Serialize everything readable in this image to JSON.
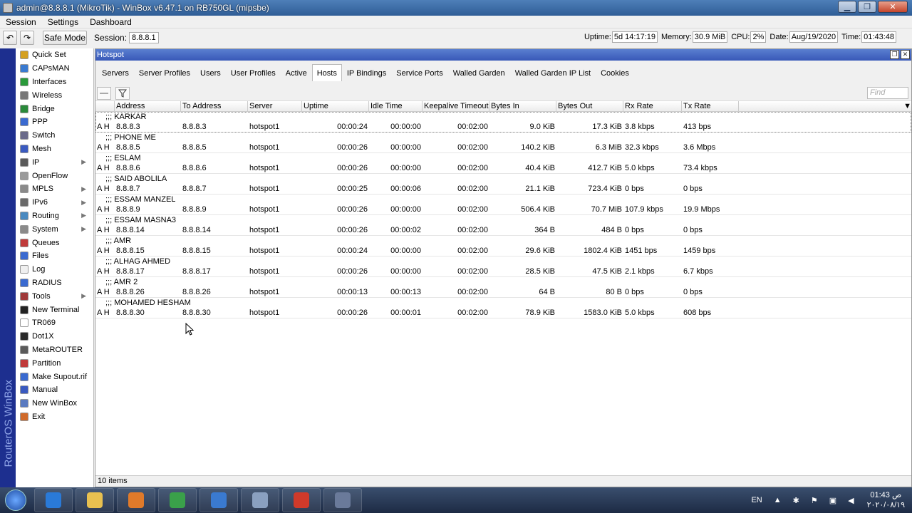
{
  "window": {
    "title": "admin@8.8.8.1 (MikroTik) - WinBox v6.47.1 on RB750GL (mipsbe)",
    "buttons": [
      "▁",
      "❐",
      "✕"
    ]
  },
  "menu": [
    "Session",
    "Settings",
    "Dashboard"
  ],
  "toolbar": {
    "undo": "↶",
    "redo": "↷",
    "safe_mode": "Safe Mode",
    "session_label": "Session:",
    "session_value": "8.8.8.1",
    "stats": [
      {
        "label": "Uptime:",
        "value": "5d 14:17:19"
      },
      {
        "label": "Memory:",
        "value": "30.9 MiB"
      },
      {
        "label": "CPU:",
        "value": "2%"
      },
      {
        "label": "Date:",
        "value": "Aug/19/2020"
      },
      {
        "label": "Time:",
        "value": "01:43:48"
      }
    ]
  },
  "brand": "RouterOS WinBox",
  "sidebar": {
    "items": [
      {
        "label": "Quick Set",
        "icon": "quick-set-icon",
        "color": "#d4a020",
        "sub": false
      },
      {
        "label": "CAPsMAN",
        "icon": "capsman-icon",
        "color": "#3a7ad0",
        "sub": false
      },
      {
        "label": "Interfaces",
        "icon": "interfaces-icon",
        "color": "#2a9a3a",
        "sub": false
      },
      {
        "label": "Wireless",
        "icon": "wireless-icon",
        "color": "#777777",
        "sub": false
      },
      {
        "label": "Bridge",
        "icon": "bridge-icon",
        "color": "#2a8a3a",
        "sub": false
      },
      {
        "label": "PPP",
        "icon": "ppp-icon",
        "color": "#3a6ad0",
        "sub": false
      },
      {
        "label": "Switch",
        "icon": "switch-icon",
        "color": "#6a6a8a",
        "sub": false
      },
      {
        "label": "Mesh",
        "icon": "mesh-icon",
        "color": "#3a5ac0",
        "sub": false
      },
      {
        "label": "IP",
        "icon": "ip-icon",
        "color": "#5a5a5a",
        "sub": true
      },
      {
        "label": "OpenFlow",
        "icon": "openflow-icon",
        "color": "#9a9a9a",
        "sub": false
      },
      {
        "label": "MPLS",
        "icon": "mpls-icon",
        "color": "#8a8a8a",
        "sub": true
      },
      {
        "label": "IPv6",
        "icon": "ipv6-icon",
        "color": "#6a6a6a",
        "sub": true
      },
      {
        "label": "Routing",
        "icon": "routing-icon",
        "color": "#4a8ac0",
        "sub": true
      },
      {
        "label": "System",
        "icon": "system-icon",
        "color": "#8a8a8a",
        "sub": true
      },
      {
        "label": "Queues",
        "icon": "queues-icon",
        "color": "#c03a3a",
        "sub": false
      },
      {
        "label": "Files",
        "icon": "files-icon",
        "color": "#3a6ad0",
        "sub": false
      },
      {
        "label": "Log",
        "icon": "log-icon",
        "color": "#f0f0f0",
        "sub": false
      },
      {
        "label": "RADIUS",
        "icon": "radius-icon",
        "color": "#3a6ad0",
        "sub": false
      },
      {
        "label": "Tools",
        "icon": "tools-icon",
        "color": "#a03a3a",
        "sub": true
      },
      {
        "label": "New Terminal",
        "icon": "terminal-icon",
        "color": "#222222",
        "sub": false
      },
      {
        "label": "TR069",
        "icon": "tr069-icon",
        "color": "#ffffff",
        "sub": false
      },
      {
        "label": "Dot1X",
        "icon": "dot1x-icon",
        "color": "#2a2a2a",
        "sub": false
      },
      {
        "label": "MetaROUTER",
        "icon": "metarouter-icon",
        "color": "#5a5a5a",
        "sub": false
      },
      {
        "label": "Partition",
        "icon": "partition-icon",
        "color": "#c03a3a",
        "sub": false
      },
      {
        "label": "Make Supout.rif",
        "icon": "supout-icon",
        "color": "#3a6ad0",
        "sub": false
      },
      {
        "label": "Manual",
        "icon": "manual-icon",
        "color": "#3a5ac0",
        "sub": false
      },
      {
        "label": "New WinBox",
        "icon": "winbox-icon",
        "color": "#5a7ac0",
        "sub": false
      },
      {
        "label": "Exit",
        "icon": "exit-icon",
        "color": "#d06a2a",
        "sub": false
      }
    ]
  },
  "hotspot": {
    "title": "Hotspot",
    "tabs": [
      {
        "label": "Servers",
        "active": false
      },
      {
        "label": "Server Profiles",
        "active": false
      },
      {
        "label": "Users",
        "active": false
      },
      {
        "label": "User Profiles",
        "active": false
      },
      {
        "label": "Active",
        "active": false
      },
      {
        "label": "Hosts",
        "active": true
      },
      {
        "label": "IP Bindings",
        "active": false
      },
      {
        "label": "Service Ports",
        "active": false
      },
      {
        "label": "Walled Garden",
        "active": false
      },
      {
        "label": "Walled Garden IP List",
        "active": false
      },
      {
        "label": "Cookies",
        "active": false
      }
    ],
    "find_placeholder": "Find",
    "columns": [
      "",
      "Address",
      "To Address",
      "Server",
      "Uptime",
      "Idle Time",
      "Keepalive Timeout",
      "Bytes In",
      "Bytes Out",
      "Rx Rate",
      "Tx Rate"
    ],
    "rows": [
      {
        "comment": ";;; KARKAR",
        "flags": "A H",
        "address": "8.8.8.3",
        "to_address": "8.8.8.3",
        "server": "hotspot1",
        "uptime": "00:00:24",
        "idle": "00:00:00",
        "keepalive": "00:02:00",
        "bytes_in": "9.0 KiB",
        "bytes_out": "17.3 KiB",
        "rx": "3.8 kbps",
        "tx": "413 bps"
      },
      {
        "comment": ";;; PHONE ME",
        "flags": "A H",
        "address": "8.8.8.5",
        "to_address": "8.8.8.5",
        "server": "hotspot1",
        "uptime": "00:00:26",
        "idle": "00:00:00",
        "keepalive": "00:02:00",
        "bytes_in": "140.2 KiB",
        "bytes_out": "6.3 MiB",
        "rx": "32.3 kbps",
        "tx": "3.6 Mbps"
      },
      {
        "comment": ";;; ESLAM",
        "flags": "A H",
        "address": "8.8.8.6",
        "to_address": "8.8.8.6",
        "server": "hotspot1",
        "uptime": "00:00:26",
        "idle": "00:00:00",
        "keepalive": "00:02:00",
        "bytes_in": "40.4 KiB",
        "bytes_out": "412.7 KiB",
        "rx": "5.0 kbps",
        "tx": "73.4 kbps"
      },
      {
        "comment": ";;; SAID ABOLILA",
        "flags": "A H",
        "address": "8.8.8.7",
        "to_address": "8.8.8.7",
        "server": "hotspot1",
        "uptime": "00:00:25",
        "idle": "00:00:06",
        "keepalive": "00:02:00",
        "bytes_in": "21.1 KiB",
        "bytes_out": "723.4 KiB",
        "rx": "0 bps",
        "tx": "0 bps"
      },
      {
        "comment": ";;; ESSAM MANZEL",
        "flags": "A H",
        "address": "8.8.8.9",
        "to_address": "8.8.8.9",
        "server": "hotspot1",
        "uptime": "00:00:26",
        "idle": "00:00:00",
        "keepalive": "00:02:00",
        "bytes_in": "506.4 KiB",
        "bytes_out": "70.7 MiB",
        "rx": "107.9 kbps",
        "tx": "19.9 Mbps"
      },
      {
        "comment": ";;; ESSAM MASNA3",
        "flags": "A H",
        "address": "8.8.8.14",
        "to_address": "8.8.8.14",
        "server": "hotspot1",
        "uptime": "00:00:26",
        "idle": "00:00:02",
        "keepalive": "00:02:00",
        "bytes_in": "364 B",
        "bytes_out": "484 B",
        "rx": "0 bps",
        "tx": "0 bps"
      },
      {
        "comment": ";;; AMR",
        "flags": "A H",
        "address": "8.8.8.15",
        "to_address": "8.8.8.15",
        "server": "hotspot1",
        "uptime": "00:00:24",
        "idle": "00:00:00",
        "keepalive": "00:02:00",
        "bytes_in": "29.6 KiB",
        "bytes_out": "1802.4 KiB",
        "rx": "1451 bps",
        "tx": "1459 bps"
      },
      {
        "comment": ";;; ALHAG AHMED",
        "flags": "A H",
        "address": "8.8.8.17",
        "to_address": "8.8.8.17",
        "server": "hotspot1",
        "uptime": "00:00:26",
        "idle": "00:00:00",
        "keepalive": "00:02:00",
        "bytes_in": "28.5 KiB",
        "bytes_out": "47.5 KiB",
        "rx": "2.1 kbps",
        "tx": "6.7 kbps"
      },
      {
        "comment": ";;; AMR 2",
        "flags": "A H",
        "address": "8.8.8.26",
        "to_address": "8.8.8.26",
        "server": "hotspot1",
        "uptime": "00:00:13",
        "idle": "00:00:13",
        "keepalive": "00:02:00",
        "bytes_in": "64 B",
        "bytes_out": "80 B",
        "rx": "0 bps",
        "tx": "0 bps"
      },
      {
        "comment": ";;; MOHAMED HESHAM",
        "flags": "A H",
        "address": "8.8.8.30",
        "to_address": "8.8.8.30",
        "server": "hotspot1",
        "uptime": "00:00:26",
        "idle": "00:00:01",
        "keepalive": "00:02:00",
        "bytes_in": "78.9 KiB",
        "bytes_out": "1583.0 KiB",
        "rx": "5.0 kbps",
        "tx": "608 bps"
      }
    ],
    "status": "10 items"
  },
  "taskbar": {
    "apps": [
      {
        "name": "ie-icon",
        "color": "#2a7ad8"
      },
      {
        "name": "explorer-icon",
        "color": "#e8c050"
      },
      {
        "name": "media-icon",
        "color": "#e07a2a"
      },
      {
        "name": "chrome-icon",
        "color": "#3aa04a"
      },
      {
        "name": "app-blue-icon",
        "color": "#3a7ad0"
      },
      {
        "name": "app-xd-icon",
        "color": "#8aa0c0"
      },
      {
        "name": "power-icon",
        "color": "#d03a2a"
      },
      {
        "name": "winbox-task-icon",
        "color": "#6a7a9a"
      }
    ],
    "lang": "EN",
    "clock_time": "01:43 ص",
    "clock_date": "٢٠٢٠/٠٨/١٩"
  }
}
